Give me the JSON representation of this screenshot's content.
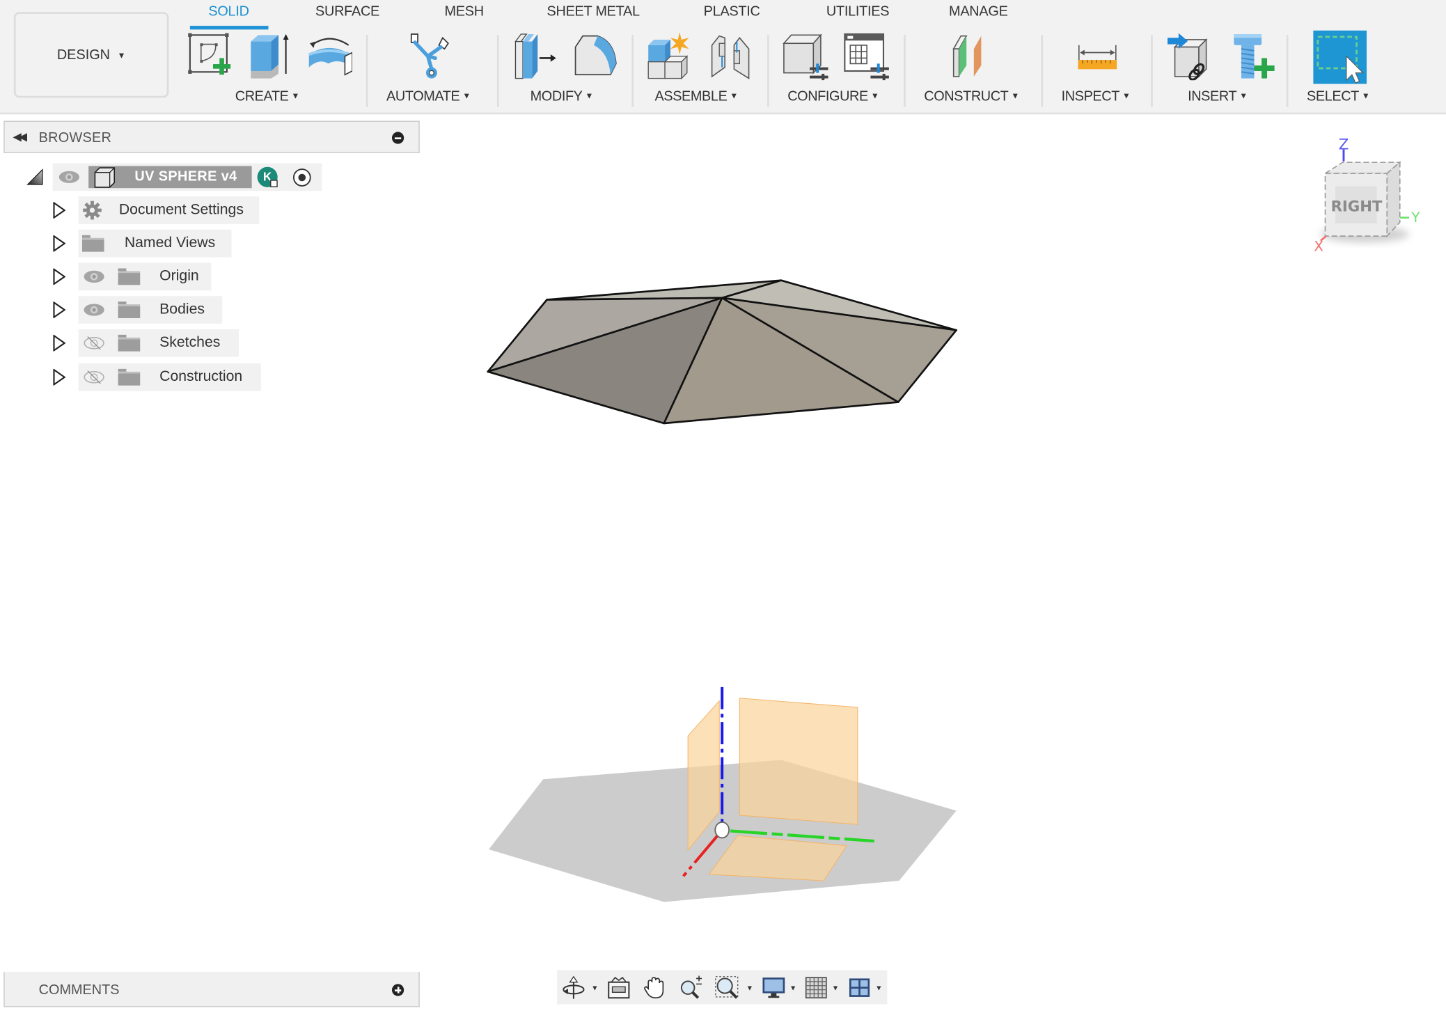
{
  "workspace": {
    "label": "DESIGN",
    "caret": "▼"
  },
  "tabs": [
    {
      "label": "SOLID",
      "active": true
    },
    {
      "label": "SURFACE",
      "active": false
    },
    {
      "label": "MESH",
      "active": false
    },
    {
      "label": "SHEET METAL",
      "active": false
    },
    {
      "label": "PLASTIC",
      "active": false
    },
    {
      "label": "UTILITIES",
      "active": false
    },
    {
      "label": "MANAGE",
      "active": false
    }
  ],
  "toolbar_groups": [
    {
      "label": "CREATE",
      "icons": [
        "create-sketch-icon",
        "extrude-icon",
        "revolve-icon"
      ]
    },
    {
      "label": "AUTOMATE",
      "icons": [
        "automate-icon"
      ]
    },
    {
      "label": "MODIFY",
      "icons": [
        "press-pull-icon",
        "fillet-icon"
      ]
    },
    {
      "label": "ASSEMBLE",
      "icons": [
        "new-component-icon",
        "joint-icon"
      ]
    },
    {
      "label": "CONFIGURE",
      "icons": [
        "configure-icon",
        "configuration-table-icon"
      ]
    },
    {
      "label": "CONSTRUCT",
      "icons": [
        "offset-plane-icon"
      ]
    },
    {
      "label": "INSPECT",
      "icons": [
        "measure-icon"
      ]
    },
    {
      "label": "INSERT",
      "icons": [
        "insert-derive-icon",
        "insert-mcmaster-icon"
      ]
    },
    {
      "label": "SELECT",
      "icons": [
        "window-select-icon"
      ]
    }
  ],
  "caret": "▼",
  "browser": {
    "title": "BROWSER",
    "collapse_glyph": "◀◀",
    "root": {
      "label": "UV SPHERE v4",
      "badge": "K"
    },
    "items": [
      {
        "label": "Document Settings",
        "icon": "gear-icon",
        "visibility": "none"
      },
      {
        "label": "Named Views",
        "icon": "folder-icon",
        "visibility": "none"
      },
      {
        "label": "Origin",
        "icon": "folder-icon",
        "visibility": "visible"
      },
      {
        "label": "Bodies",
        "icon": "folder-icon",
        "visibility": "visible"
      },
      {
        "label": "Sketches",
        "icon": "folder-icon",
        "visibility": "hidden"
      },
      {
        "label": "Construction",
        "icon": "folder-icon",
        "visibility": "hidden"
      }
    ]
  },
  "comments": {
    "title": "COMMENTS"
  },
  "viewcube": {
    "face": "RIGHT",
    "axis_z": "Z",
    "axis_y": "Y",
    "axis_x": "X"
  },
  "navbar": {
    "tools": [
      "orbit-icon",
      "look-at-icon",
      "pan-icon",
      "zoom-icon",
      "fit-window-icon",
      "display-settings-icon",
      "grid-settings-icon",
      "viewports-icon"
    ]
  },
  "colors": {
    "accent": "#1b8fd2",
    "select_blue": "#1e96d4",
    "axis_x": "#e82020",
    "axis_y": "#28d428",
    "axis_z": "#1a1ae6",
    "plane": "#fbd49a",
    "body": "#a39d93",
    "badge": "#1b8a78"
  }
}
